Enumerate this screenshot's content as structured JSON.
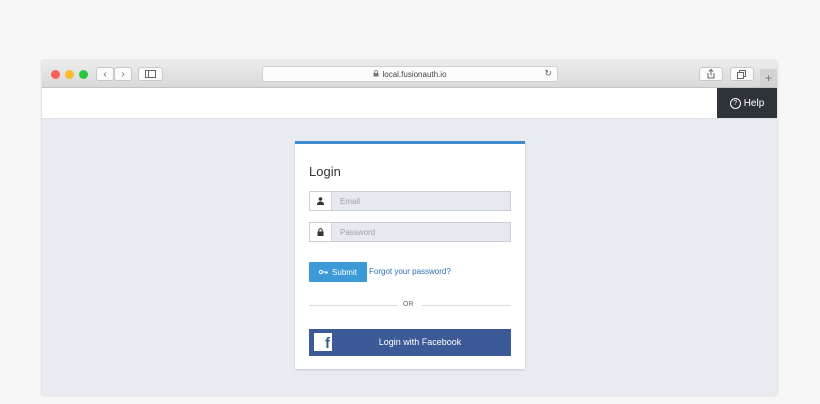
{
  "browser": {
    "url": "local.fusionauth.io",
    "traffic_lights": [
      "#fc5f57",
      "#fdbc2e",
      "#28c840"
    ],
    "nav_back_icon": "chevron-left-icon",
    "nav_forward_icon": "chevron-right-icon",
    "sidebar_icon": "sidebar-icon",
    "reload_icon": "reload-icon",
    "share_icon": "share-icon",
    "tabs_icon": "tabs-icon",
    "new_tab_icon": "plus-icon"
  },
  "header": {
    "help_label": "Help",
    "help_icon": "question-circle-icon",
    "help_bg": "#2d3338"
  },
  "login": {
    "title": "Login",
    "accent": "#3f8bd0",
    "email_placeholder": "Email",
    "email_icon": "user-icon",
    "password_placeholder": "Password",
    "password_icon": "lock-icon",
    "submit_label": "Submit",
    "submit_icon": "key-icon",
    "submit_color": "#3d9ad8",
    "forgot_label": "Forgot your password?",
    "or_label": "OR",
    "facebook_label": "Login with Facebook",
    "facebook_icon": "facebook-icon",
    "facebook_color": "#3d5a98"
  }
}
